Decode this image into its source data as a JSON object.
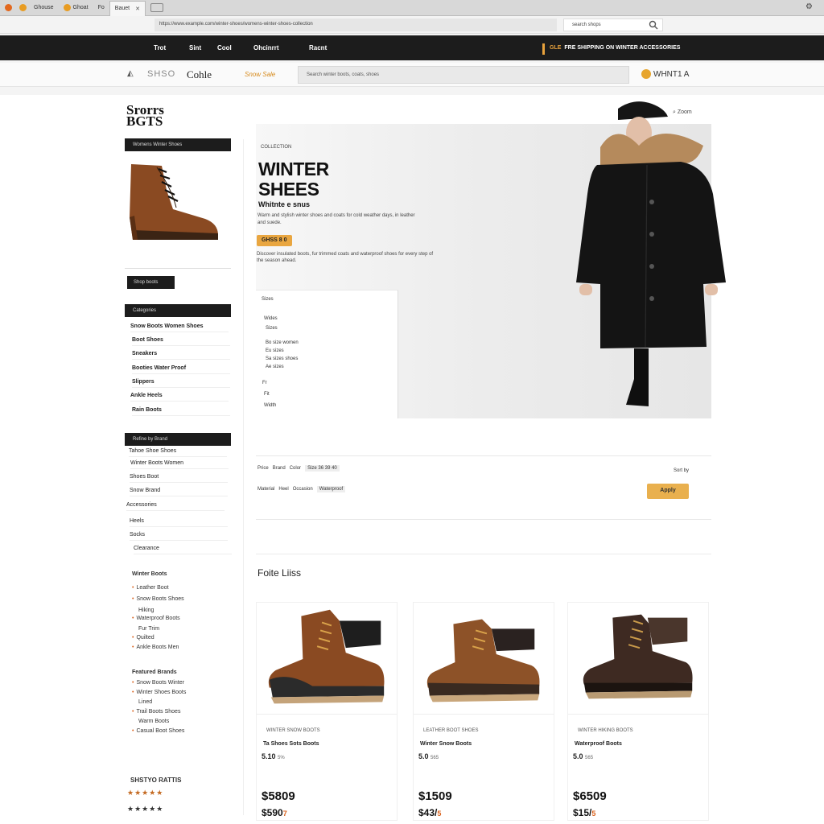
{
  "browser": {
    "tabs": [
      {
        "label": "Ghouse",
        "color": "#e2681e",
        "active": false
      },
      {
        "label": "Ghoat",
        "color": "#e89c22",
        "active": false
      },
      {
        "label": "Fo",
        "color": "#888888",
        "active": false
      },
      {
        "label": "Bauet",
        "color": "",
        "active": true
      }
    ],
    "address": "https://www.example.com/winter-shoes/womens-winter-shoes-collection",
    "address_right": "search shops"
  },
  "topnav": {
    "items": [
      "Trot",
      "Sint",
      "Cool",
      "Ohcinrrt",
      "Racnt"
    ],
    "promo_prefix": "GLE",
    "promo": "FRE SHIPPING ON WINTER ACCESSORIES"
  },
  "searchbar": {
    "logo_text": "SHSO",
    "logo_word": "Cohle",
    "sale_tag": "Snow Sale",
    "placeholder": "Search winter boots, coats, shoes",
    "account": "WHNT1 A"
  },
  "sidebar": {
    "brand": "Srorrs\nBGTS",
    "head1": "Womens Winter Shoes",
    "cta": "Shop boots",
    "head2": "Categories",
    "links": [
      "Snow Boots Women Shoes",
      "Boot Shoes",
      "Sneakers",
      "Booties Water Proof",
      "Slippers",
      "Ankle Heels",
      "Rain Boots"
    ],
    "head3": "Refine by Brand",
    "links2": [
      "Tahoe Shoe Shoes",
      "Winter Boots Women",
      "Shoes Boot",
      "Snow Brand",
      "Accessories",
      "Heels",
      "Socks",
      "Clearance"
    ],
    "section3": "Winter Boots",
    "sub3": [
      "Leather Boot",
      "Snow Boots Shoes",
      "Hiking",
      "Waterproof Boots",
      "Fur Trim",
      "Quilted",
      "Ankle Boots Men"
    ],
    "section4": "Featured Brands",
    "sub4": [
      "Snow Boots Winter",
      "Winter Shoes Boots",
      "Lined",
      "Trail Boots Shoes",
      "Warm Boots",
      "Casual Boot Shoes"
    ],
    "footer": "SHSTYO RATTIS",
    "stars1": "★★★★★",
    "stars2": "★★★★★"
  },
  "hero": {
    "kicker": "COLLECTION",
    "title_line1": "WINTER",
    "title_line2": "SHEES",
    "subtitle": "Whitnte e snus",
    "desc": "Warm and stylish winter shoes and coats for cold weather days, in leather and suede.",
    "cta": "GHSS 8 0",
    "desc2": "Discover insulated boots, fur trimmed coats and waterproof shoes for every step of the season ahead.",
    "zoom": "Zoom",
    "panel": [
      "Sizes",
      "Wides",
      "Sizes",
      "Bo size women",
      "Eu sizes",
      "Sa sizes shoes",
      "Ae sizes",
      "Fr",
      "Fit",
      "Width"
    ]
  },
  "filters": {
    "line1": [
      "Price",
      "Brand",
      "Color",
      "Size 36 39 40"
    ],
    "line2": [
      "Material",
      "Heel",
      "Occasion",
      "Waterproof"
    ],
    "sort_label": "Sort by",
    "apply": "Apply"
  },
  "products": {
    "title": "Foite Liiss",
    "items": [
      {
        "brand": "WINTER SNOW BOOTS",
        "name": "Ta Shoes Sots Boots",
        "rating": "5.10",
        "reviews": "5%",
        "price": "$5809",
        "old_price": "$590",
        "old_suffix": "7"
      },
      {
        "brand": "LEATHER BOOT SHOES",
        "name": "Winter Snow Boots",
        "rating": "5.0",
        "reviews": "565",
        "price": "$1509",
        "old_price": "$43/",
        "old_suffix": "5"
      },
      {
        "brand": "WINTER HIKING BOOTS",
        "name": "Waterproof Boots",
        "rating": "5.0",
        "reviews": "565",
        "price": "$6509",
        "old_price": "$15/",
        "old_suffix": "5"
      }
    ]
  },
  "colors": {
    "nav_dark": "#1c1c1c",
    "accent": "#e9a640",
    "bullet": "#d9611c"
  }
}
